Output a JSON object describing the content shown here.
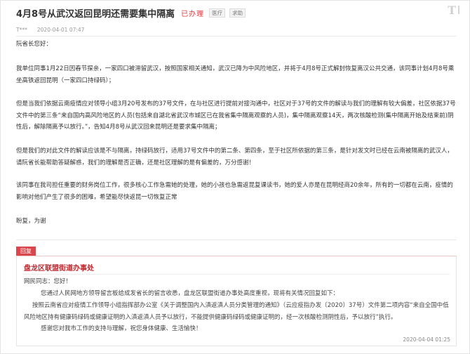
{
  "page": {
    "logo_text": "T",
    "title": "4月8号从武汉返回昆明还需要集中隔离",
    "status": "已办理",
    "tags": [
      "医疗",
      "求助"
    ]
  },
  "author": {
    "name": "T***",
    "time": "2020-04-01 07:47"
  },
  "message": {
    "greeting": "阮省长您好：",
    "paragraphs": [
      "我单位同事1月22日因春节探亲，一家四口被滞留武汉，按照国家相关通知，武汉已降为中风险地区，并将于4月8号正式解封恢复离汉公共交通，该同事计划4月8号乘坐高铁返回昆明（一家四口持绿码）；",
      "但是当我们依据云南疫情应对领导小组3月20号发布的37号文件，在与社区进行提前对接沟通中，社区对于37号的文件的解读与我们的理解有较大偏差，社区依据37号文件中的第三条“来自国内高风险地区的人员(包括来自湖北省武汉市城区已在我省集中隔离观察的人员)，集中隔离观察14天，两次核酸检测(集中隔离开始及结束前)阴性后，解除隔离予以放行。”，告知4月8号从武汉回来昆明还是要求集中隔离；",
      "但是我们的对此文件的解读应该是不与隔离，持绿码放行，适用37号文件中的第二条、第四条，至于社区所依据的第三条，是针对发文时已经在云南被隔离的武汉人，请阮省长能帮助答疑解惑，我们的理解是否正确，还是社区理解的是有偏差的，万分感谢！",
      "该同事在我司担任重要的财务岗位工作，很多核心工作急需她的处理，她的小孩也急需返昆复课读书，她的爱人亦是在昆明经商20余年，所有的一切都在云南，疫情的影响对他们产生了很多的困难，希望能尽快返昆一切恢复正常"
    ],
    "closing": "盼复，为谢"
  },
  "reply": {
    "badge": "回复",
    "org": "盘龙区联盟街道办事处",
    "salutation": "网民同志：您好！",
    "paragraphs": [
      "您通过人民网地方领导留言板给成发省长的留言收悉，盘龙区联盟街道办事处高度重视，现将有关情况回复如下：",
      "按照云南省应对疫情工作领导小组指挥部办公室《关于调整国内入滇返滇人员分类管理的通知》（云应疫指办发〔2020〕37号）文件第二项内容“来自全国中低风险地区持有健康码绿码或健康证明的入滇返滇人员予以放行，不能提供健康码绿码或健康证明的，经一次核酸检测阴性后，予以放行”执行。",
      "感谢您对我市工作的支持与理解，祝您身体健康、生活愉快！"
    ],
    "time": "2020-04-04 01:25"
  },
  "colors": {
    "accent": "#d9474c",
    "org": "#c0282e",
    "status": "#e0393e"
  }
}
